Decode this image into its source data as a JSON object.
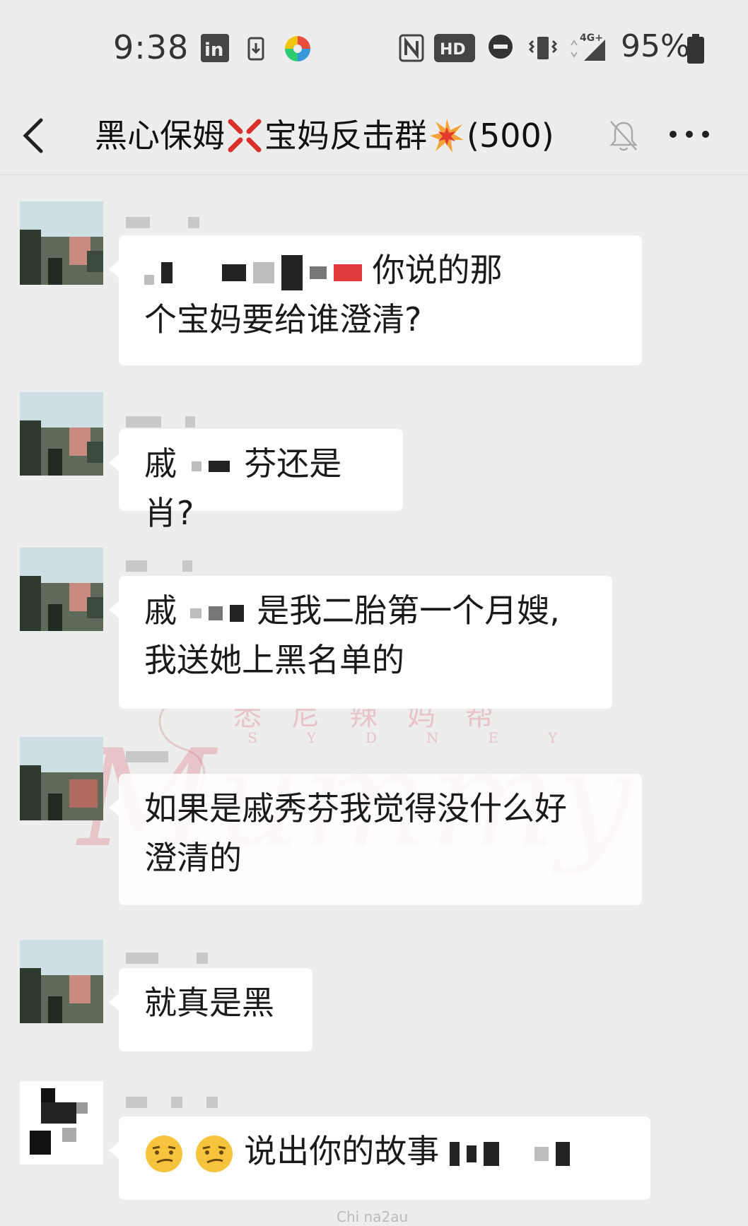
{
  "status_bar": {
    "time": "9:38",
    "battery": "95%",
    "network": "4G+",
    "icons": [
      "linkedin-icon",
      "download-icon",
      "app-icon",
      "nfc-icon",
      "hd-icon",
      "dnd-icon",
      "vibrate-icon",
      "signal-icon",
      "battery-icon"
    ]
  },
  "header": {
    "title_part1": "黑心保姆",
    "title_part2": "宝妈反击群",
    "member_count": "(500)",
    "title_emojis": [
      "anger-emoji",
      "collision-emoji"
    ]
  },
  "messages": [
    {
      "text_before": "",
      "text_after": "你说的那",
      "line2": "个宝妈要给谁澄清?"
    },
    {
      "text_before": "戚",
      "text_after": "芬还是肖?"
    },
    {
      "text_before": "戚",
      "text_after": "是我二胎第一个月嫂,",
      "line2": "我送她上黑名单的"
    },
    {
      "text": "如果是戚秀芬我觉得没什么好",
      "line2": "澄清的"
    },
    {
      "text": "就真是黑"
    },
    {
      "text_after": "说出你的故事"
    }
  ],
  "watermark": {
    "chinese": "悉尼辣妈帮",
    "english": "SYDNEY",
    "brand": "Mummy",
    "bottom": "Chi na2au"
  }
}
